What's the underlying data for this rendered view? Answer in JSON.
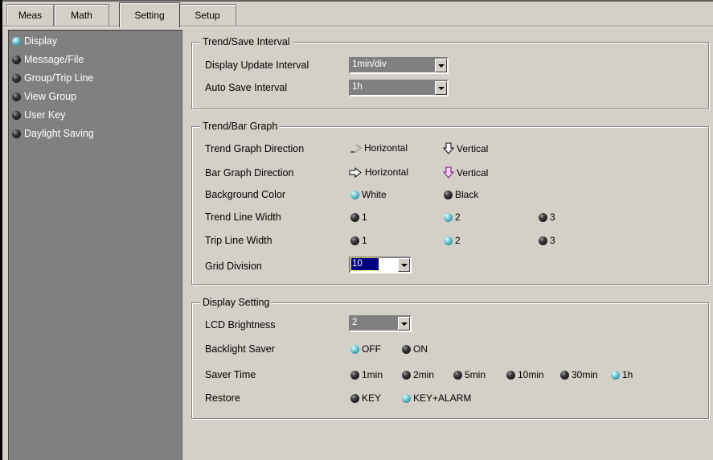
{
  "tabs": [
    "Meas",
    "Math",
    "Setting",
    "Setup"
  ],
  "sidebar": {
    "items": [
      {
        "label": "Display",
        "selected": true
      },
      {
        "label": "Message/File",
        "selected": false
      },
      {
        "label": "Group/Trip Line",
        "selected": false
      },
      {
        "label": "View Group",
        "selected": false
      },
      {
        "label": "User Key",
        "selected": false
      },
      {
        "label": "Daylight Saving",
        "selected": false
      }
    ]
  },
  "trend_save": {
    "title": "Trend/Save Interval",
    "display_update_label": "Display Update Interval",
    "display_update_value": "1min/div",
    "auto_save_label": "Auto Save Interval",
    "auto_save_value": "1h"
  },
  "trend_bar": {
    "title": "Trend/Bar Graph",
    "trend_dir_label": "Trend Graph Direction",
    "trend_dir_options": [
      "Horizontal",
      "Vertical"
    ],
    "trend_dir_selected": "Horizontal",
    "bar_dir_label": "Bar Graph Direction",
    "bar_dir_options": [
      "Horizontal",
      "Vertical"
    ],
    "bar_dir_selected": "Vertical",
    "bg_color_label": "Background Color",
    "bg_color_options": [
      "White",
      "Black"
    ],
    "bg_color_selected": "White",
    "trend_line_label": "Trend Line Width",
    "trend_line_options": [
      "1",
      "2",
      "3"
    ],
    "trend_line_selected": "2",
    "trip_line_label": "Trip Line Width",
    "trip_line_options": [
      "1",
      "2",
      "3"
    ],
    "trip_line_selected": "2",
    "grid_label": "Grid Division",
    "grid_value": "10"
  },
  "display_setting": {
    "title": "Display Setting",
    "lcd_label": "LCD Brightness",
    "lcd_value": "2",
    "backlight_label": "Backlight Saver",
    "backlight_options": [
      "OFF",
      "ON"
    ],
    "backlight_selected": "OFF",
    "saver_time_label": "Saver Time",
    "saver_time_options": [
      "1min",
      "2min",
      "5min",
      "10min",
      "30min",
      "1h"
    ],
    "saver_time_selected": "1h",
    "restore_label": "Restore",
    "restore_options": [
      "KEY",
      "KEY+ALARM"
    ],
    "restore_selected": "KEY+ALARM"
  },
  "colors": {
    "panel_bg": "#d4d0c8",
    "sidebar_bg": "#808080",
    "selected_radio": "#5fc4d0",
    "arrow_selected": "#8a2a8a",
    "focus_fill": "#000080"
  }
}
